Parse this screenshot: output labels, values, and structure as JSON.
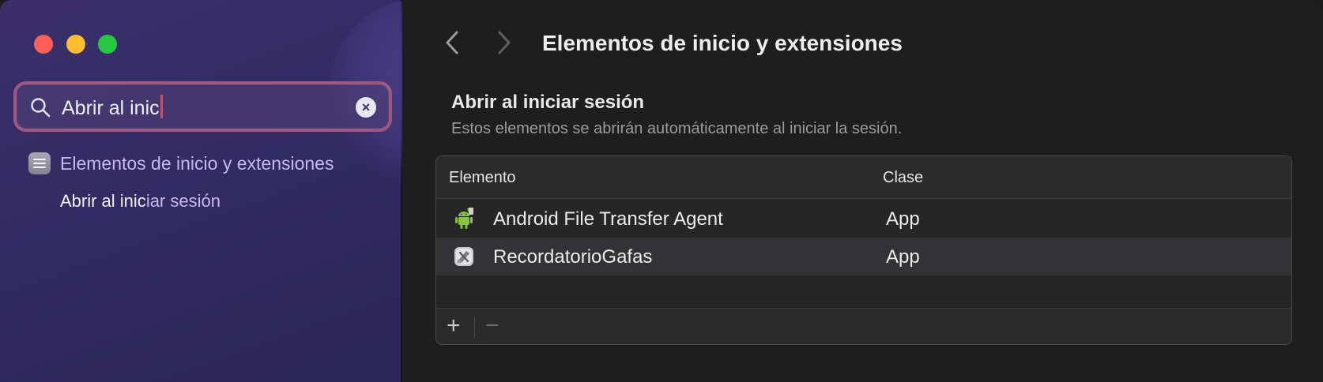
{
  "window": {
    "controls": [
      "close",
      "minimize",
      "zoom"
    ]
  },
  "sidebar": {
    "search": {
      "value": "Abrir al inic",
      "icon": "search-icon",
      "clear_icon": "clear-icon"
    },
    "results": {
      "section_label": "Elementos de inicio y extensiones",
      "section_icon": "list-icon",
      "item_match": "Abrir al inic",
      "item_rest": "iar sesión"
    }
  },
  "main": {
    "title": "Elementos de inicio y extensiones",
    "section": {
      "title": "Abrir al iniciar sesión",
      "subtitle": "Estos elementos se abrirán automáticamente al iniciar la sesión."
    },
    "table": {
      "columns": [
        "Elemento",
        "Clase"
      ],
      "rows": [
        {
          "name": "Android File Transfer Agent",
          "kind": "App",
          "icon": "android-icon"
        },
        {
          "name": "RecordatorioGafas",
          "kind": "App",
          "icon": "script-app-icon"
        }
      ],
      "add_label": "+",
      "remove_label": "−"
    }
  },
  "colors": {
    "sidebar_bg": "#322a63",
    "search_focus": "#a2577f",
    "accent_text": "#c7b9ee",
    "close": "#fe5f57",
    "minimize": "#febc2e",
    "zoom": "#28c840"
  }
}
